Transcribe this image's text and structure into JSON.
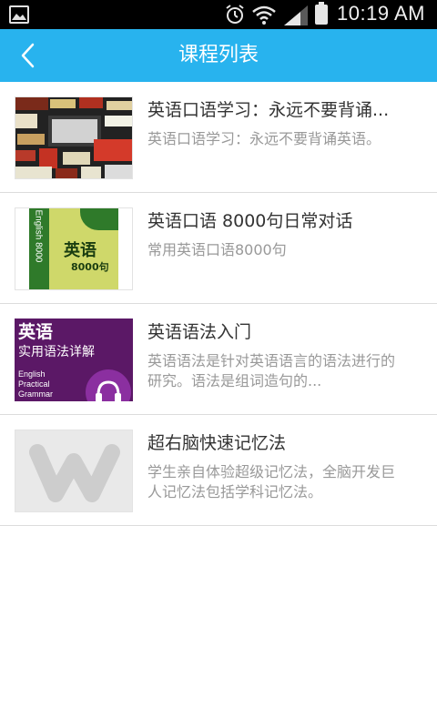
{
  "status_bar": {
    "time": "10:19 AM",
    "icons": [
      "gallery-icon",
      "alarm-icon",
      "wifi-icon",
      "signal-icon",
      "battery-icon"
    ]
  },
  "header": {
    "title": "课程列表",
    "back_icon": "chevron-left-icon"
  },
  "courses": [
    {
      "title": "英语口语学习：永远不要背诵...",
      "desc": "英语口语学习：永远不要背诵英语。",
      "thumb": "word-collage-thumbnail"
    },
    {
      "title": "英语口语 8000句日常对话",
      "desc": "常用英语口语8000句",
      "thumb": "book-cover-thumbnail",
      "thumb_text": [
        "English 8000",
        "英语",
        "8000句"
      ]
    },
    {
      "title": "英语语法入门",
      "desc": "英语语法是针对英语语言的语法进行的研究。语法是组词造句的...",
      "thumb": "grammar-cover-thumbnail",
      "thumb_text": [
        "英语",
        "实用语法详解",
        "English",
        "Practical",
        "Grammar"
      ]
    },
    {
      "title": "超右脑快速记忆法",
      "desc": "学生亲自体验超级记忆法，全脑开发巨人记忆法包括学科记忆法。",
      "thumb": "placeholder-logo-thumbnail"
    }
  ],
  "colors": {
    "header_bg": "#28b3ee",
    "status_bg": "#000000",
    "title_text": "#333333",
    "desc_text": "#999999",
    "divider": "#dcdcdc"
  }
}
